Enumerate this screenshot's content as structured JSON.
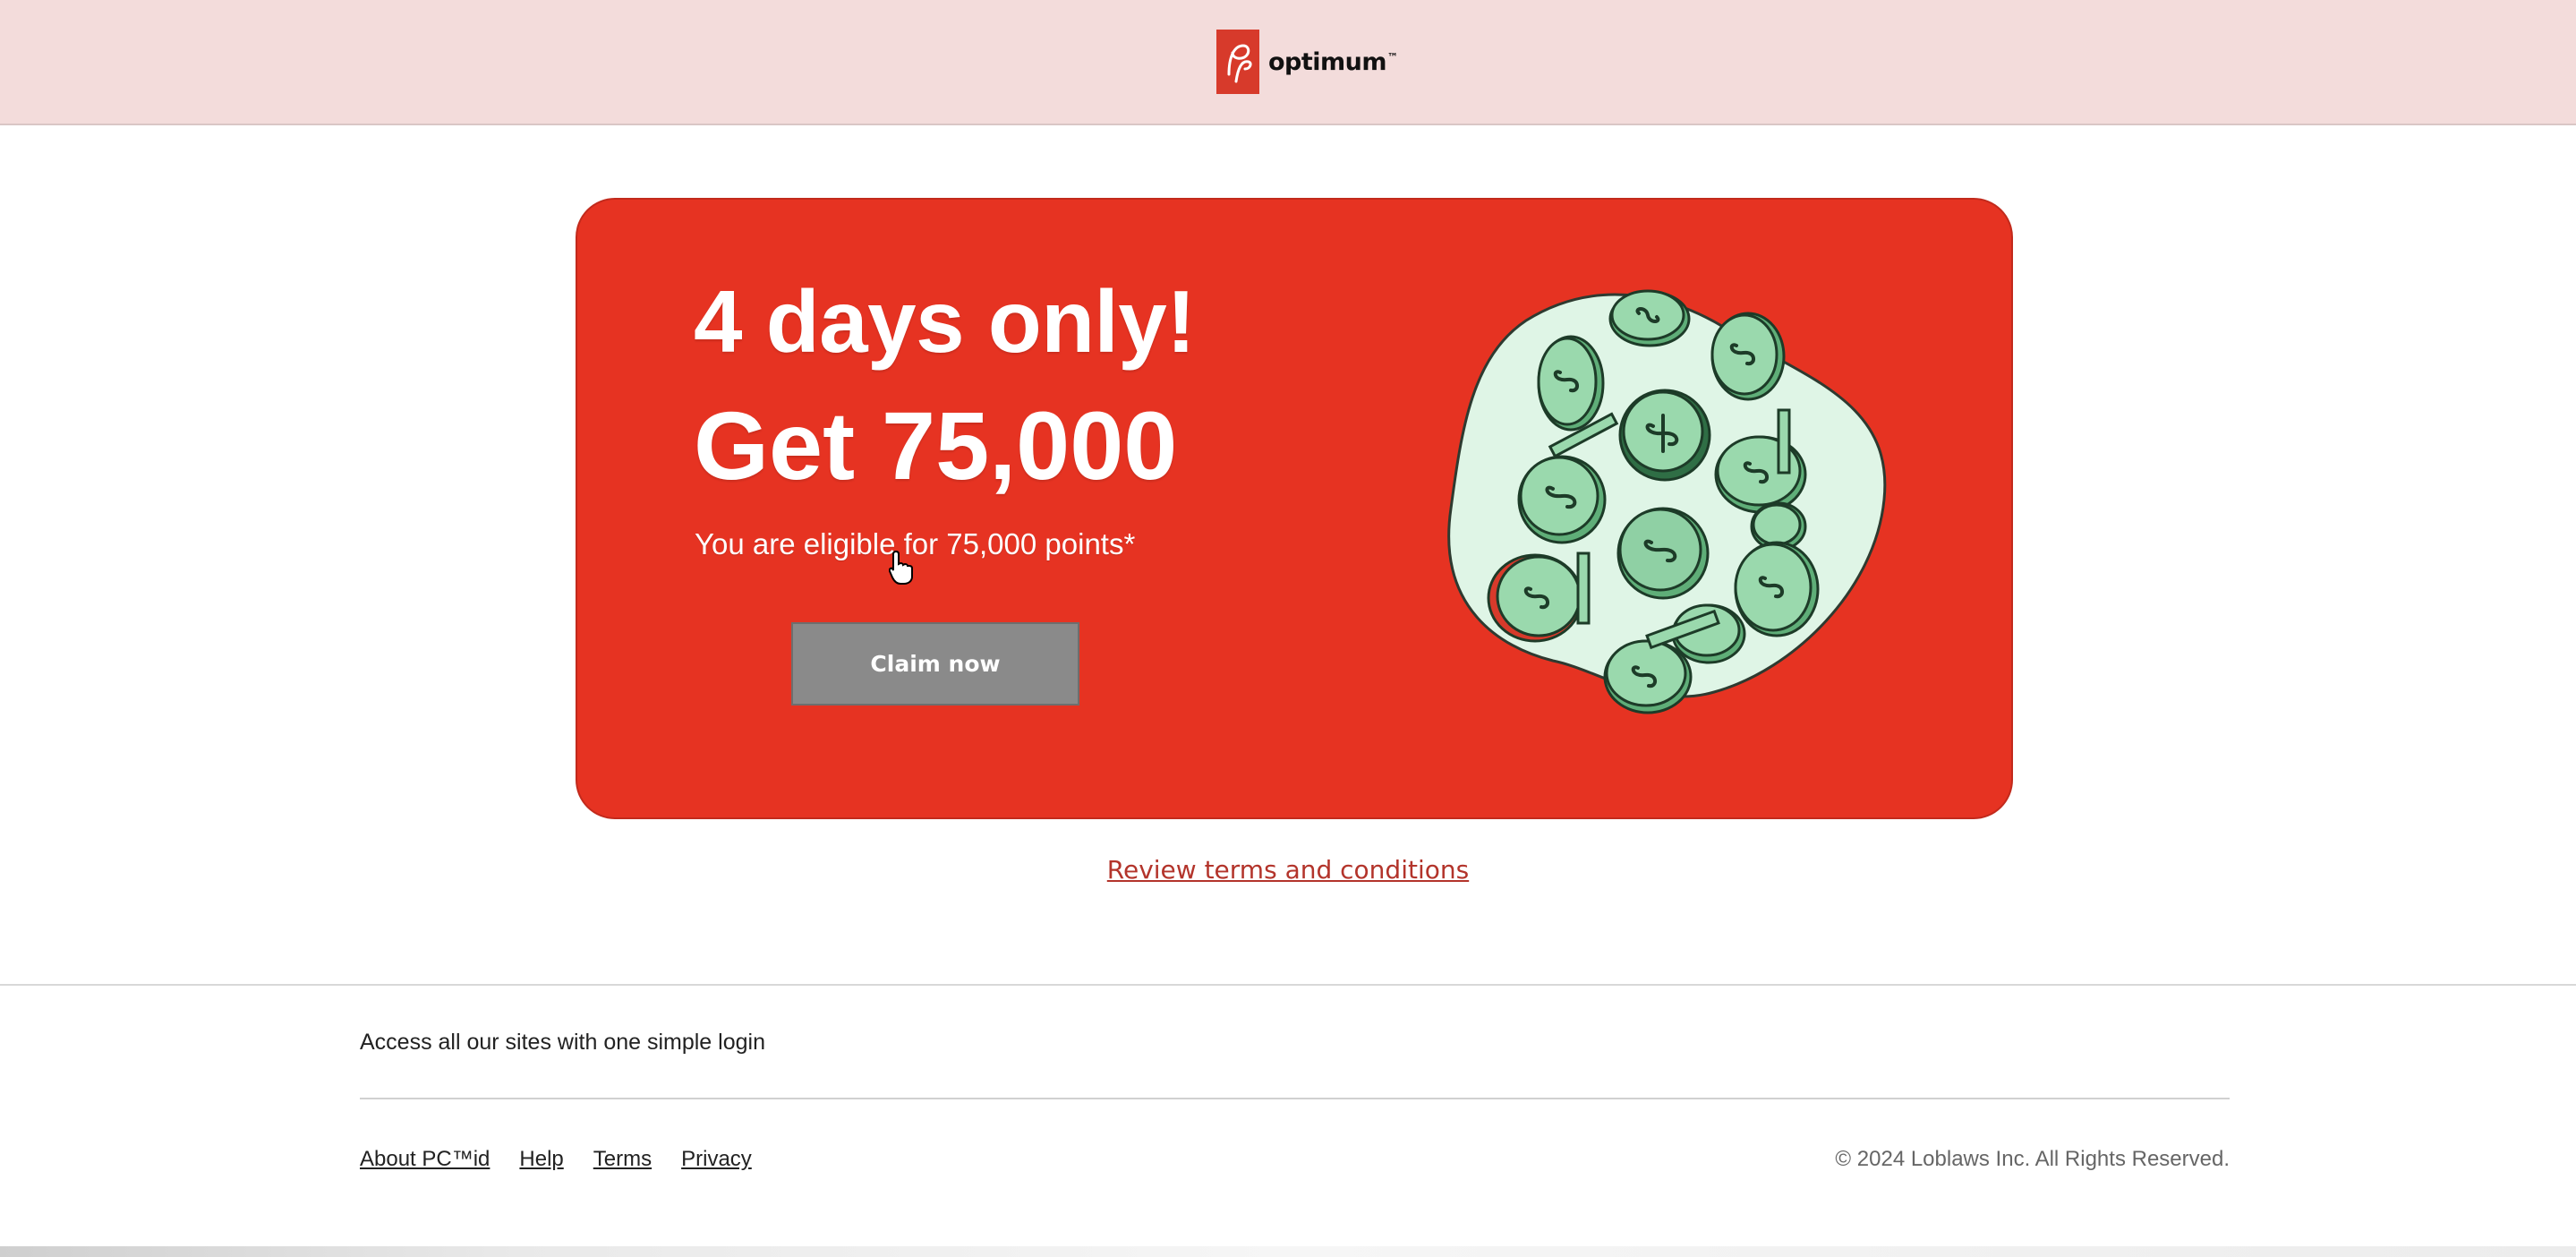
{
  "header": {
    "logo_text": "optimum",
    "logo_tm": "™",
    "logo_mark": "PC"
  },
  "promo": {
    "headline_line1": "4 days only!",
    "headline_line2": "Get 75,000",
    "subtext": "You are eligible for 75,000 points*",
    "claim_button_label": "Claim now",
    "illustration_icon": "dollar-coins-illustration",
    "colors": {
      "card_bg": "#e63322",
      "button_bg": "#8a8a8a",
      "blob": "#dff5e6",
      "coin": "#7fcb97"
    }
  },
  "terms": {
    "link_label": "Review terms and conditions"
  },
  "footer": {
    "tagline": "Access all our sites with one simple login",
    "links": [
      "About PC™id",
      "Help",
      "Terms",
      "Privacy"
    ],
    "copyright": "© 2024 Loblaws Inc. All Rights Reserved."
  }
}
